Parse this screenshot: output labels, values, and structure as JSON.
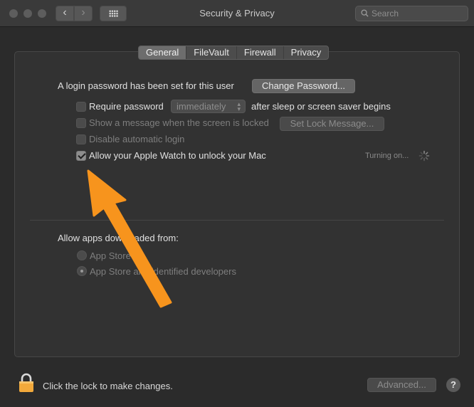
{
  "window": {
    "title": "Security & Privacy"
  },
  "toolbar": {
    "search_placeholder": "Search"
  },
  "tabs": [
    {
      "label": "General",
      "active": true
    },
    {
      "label": "FileVault",
      "active": false
    },
    {
      "label": "Firewall",
      "active": false
    },
    {
      "label": "Privacy",
      "active": false
    }
  ],
  "general": {
    "login_text": "A login password has been set for this user",
    "change_password_label": "Change Password...",
    "require_password_label": "Require password",
    "require_password_interval": "immediately",
    "require_password_suffix": "after sleep or screen saver begins",
    "show_message_label": "Show a message when the screen is locked",
    "set_lock_message_label": "Set Lock Message...",
    "disable_autologin_label": "Disable automatic login",
    "apple_watch_label": "Allow your Apple Watch to unlock your Mac",
    "apple_watch_checked": true,
    "apple_watch_status": "Turning on...",
    "allow_apps_heading": "Allow apps downloaded from:",
    "app_store_option": "App Store",
    "app_store_identified_option": "App Store and identified developers",
    "selected_option": "App Store and identified developers"
  },
  "footer": {
    "lock_text": "Click the lock to make changes.",
    "advanced_label": "Advanced...",
    "help_label": "?"
  },
  "colors": {
    "annotation_arrow": "#f7941d",
    "background": "#2b2b2b",
    "panel": "#323232"
  }
}
